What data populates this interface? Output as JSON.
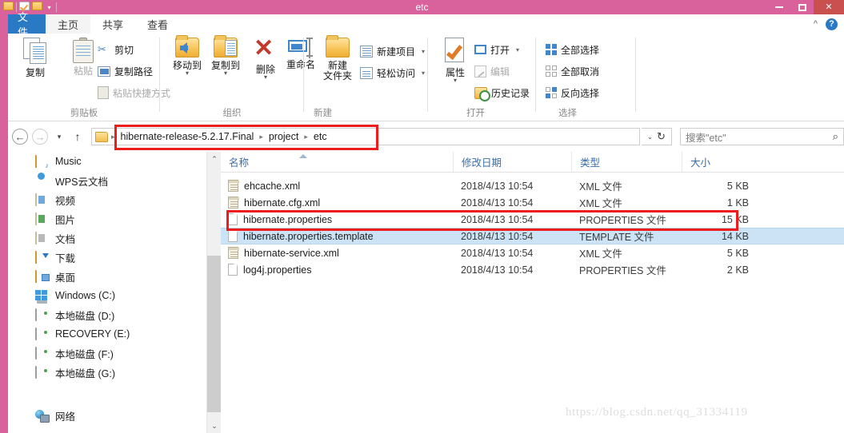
{
  "window": {
    "title": "etc",
    "minimize_label": "最小化",
    "maximize_label": "最大化",
    "close_label": "关闭",
    "accent_color": "#d9629c",
    "close_color": "#c9504f"
  },
  "quick_access": {
    "items": [
      "folder-icon",
      "checked-folder-icon",
      "folder-icon"
    ],
    "dropdown_label": "▾"
  },
  "ribbon": {
    "tabs": [
      {
        "label": "文件",
        "active": false,
        "is_file_menu": true
      },
      {
        "label": "主页",
        "active": true
      },
      {
        "label": "共享",
        "active": false
      },
      {
        "label": "查看",
        "active": false
      }
    ],
    "collapse_label": "^",
    "help_label": "?",
    "groups": [
      {
        "name": "剪贴板",
        "big_buttons": [
          {
            "label": "复制",
            "icon": "copy-icon",
            "enabled": true
          },
          {
            "label": "粘贴",
            "icon": "paste-icon",
            "enabled": false
          }
        ],
        "small_items": [
          {
            "label": "剪切",
            "icon": "scissors-icon",
            "enabled": true
          },
          {
            "label": "复制路径",
            "icon": "copy-path-icon",
            "enabled": true
          },
          {
            "label": "粘贴快捷方式",
            "icon": "paste-shortcut-icon",
            "enabled": false
          }
        ]
      },
      {
        "name": "组织",
        "big_buttons": [
          {
            "label": "移动到",
            "icon": "move-to-icon",
            "has_caret": true
          },
          {
            "label": "复制到",
            "icon": "copy-to-icon",
            "has_caret": true
          },
          {
            "label": "删除",
            "icon": "delete-icon",
            "has_caret": true
          },
          {
            "label": "重命名",
            "icon": "rename-icon",
            "has_caret": false
          }
        ]
      },
      {
        "name": "新建",
        "big_buttons": [
          {
            "label": "新建\n文件夹",
            "label_line1": "新建",
            "label_line2": "文件夹",
            "icon": "new-folder-icon"
          }
        ],
        "small_items": [
          {
            "label": "新建项目",
            "icon": "new-item-icon",
            "has_caret": true
          },
          {
            "label": "轻松访问",
            "icon": "easy-access-icon",
            "has_caret": true
          }
        ]
      },
      {
        "name": "打开",
        "big_buttons": [
          {
            "label": "属性",
            "icon": "properties-icon",
            "has_caret": true
          }
        ],
        "small_items": [
          {
            "label": "打开",
            "icon": "open-icon",
            "has_caret": true,
            "enabled": true
          },
          {
            "label": "编辑",
            "icon": "edit-icon",
            "enabled": false
          },
          {
            "label": "历史记录",
            "icon": "history-icon",
            "enabled": true
          }
        ]
      },
      {
        "name": "选择",
        "small_items": [
          {
            "label": "全部选择",
            "icon": "select-all-icon"
          },
          {
            "label": "全部取消",
            "icon": "select-none-icon"
          },
          {
            "label": "反向选择",
            "icon": "invert-selection-icon"
          }
        ]
      }
    ]
  },
  "addressbar": {
    "back_label": "←",
    "forward_label": "→",
    "recent_label": "▾",
    "up_label": "↑",
    "breadcrumbs": [
      "hibernate-release-5.2.17.Final",
      "project",
      "etc"
    ],
    "separator": "▸",
    "dropdown_label": "⌄",
    "refresh_label": "↻"
  },
  "search": {
    "placeholder": "搜索\"etc\"",
    "icon": "search-icon"
  },
  "sidebar": {
    "items": [
      {
        "label": "Music",
        "icon": "music-folder-icon"
      },
      {
        "label": "WPS云文档",
        "icon": "cloud-icon"
      },
      {
        "label": "视频",
        "icon": "videos-icon"
      },
      {
        "label": "图片",
        "icon": "pictures-icon"
      },
      {
        "label": "文档",
        "icon": "documents-icon"
      },
      {
        "label": "下载",
        "icon": "downloads-icon"
      },
      {
        "label": "桌面",
        "icon": "desktop-icon"
      },
      {
        "label": "Windows (C:)",
        "icon": "windows-drive-icon"
      },
      {
        "label": "本地磁盘 (D:)",
        "icon": "drive-icon"
      },
      {
        "label": "RECOVERY (E:)",
        "icon": "drive-icon"
      },
      {
        "label": "本地磁盘 (F:)",
        "icon": "drive-icon"
      },
      {
        "label": "本地磁盘 (G:)",
        "icon": "drive-icon"
      },
      {
        "label": "网络",
        "icon": "network-icon"
      }
    ],
    "scroll_up_label": "⌃",
    "scroll_down_label": "⌄"
  },
  "filelist": {
    "columns": [
      {
        "key": "name",
        "label": "名称",
        "sorted": "asc"
      },
      {
        "key": "date",
        "label": "修改日期"
      },
      {
        "key": "type",
        "label": "类型"
      },
      {
        "key": "size",
        "label": "大小"
      }
    ],
    "rows": [
      {
        "name": "ehcache.xml",
        "date": "2018/4/13 10:54",
        "type": "XML 文件",
        "size": "5 KB",
        "icon": "xml-file-icon",
        "selected": false
      },
      {
        "name": "hibernate.cfg.xml",
        "date": "2018/4/13 10:54",
        "type": "XML 文件",
        "size": "1 KB",
        "icon": "xml-file-icon",
        "selected": false
      },
      {
        "name": "hibernate.properties",
        "date": "2018/4/13 10:54",
        "type": "PROPERTIES 文件",
        "size": "15 KB",
        "icon": "plain-file-icon",
        "selected": false,
        "highlighted": true
      },
      {
        "name": "hibernate.properties.template",
        "date": "2018/4/13 10:54",
        "type": "TEMPLATE 文件",
        "size": "14 KB",
        "icon": "plain-file-icon",
        "selected": true
      },
      {
        "name": "hibernate-service.xml",
        "date": "2018/4/13 10:54",
        "type": "XML 文件",
        "size": "5 KB",
        "icon": "xml-file-icon",
        "selected": false
      },
      {
        "name": "log4j.properties",
        "date": "2018/4/13 10:54",
        "type": "PROPERTIES 文件",
        "size": "2 KB",
        "icon": "plain-file-icon",
        "selected": false
      }
    ]
  },
  "annotations": {
    "color": "#ee1c1c",
    "boxes": [
      "address-path-highlight",
      "hibernate-properties-row-highlight"
    ]
  },
  "watermark": {
    "text": "https://blog.csdn.net/qq_31334119"
  }
}
